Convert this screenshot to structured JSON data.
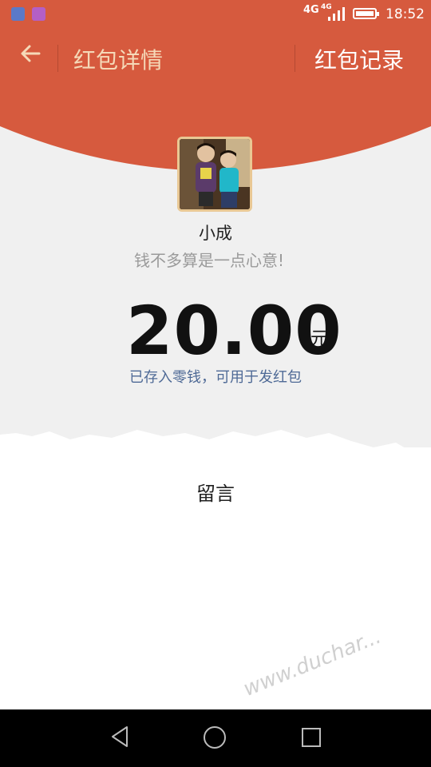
{
  "status_bar": {
    "network": "4G",
    "network2": "4G",
    "time": "18:52"
  },
  "header": {
    "back_icon": "arrow-left-icon",
    "title": "红包详情",
    "records_label": "红包记录"
  },
  "sender": {
    "avatar_icon": "user-avatar-photo",
    "name": "小成",
    "wish": "钱不多算是一点心意!"
  },
  "amount": {
    "value": "20.00",
    "unit": "元",
    "note": "已存入零钱，可用于发红包"
  },
  "message_section": {
    "label": "留言"
  },
  "watermark": {
    "text": "www.duchar..."
  },
  "colors": {
    "brand_red": "#d65a3e",
    "gold_text": "#f5d9b8",
    "note_blue": "#4f6a96"
  },
  "navigation": {
    "back_icon": "triangle-back-icon",
    "home_icon": "circle-home-icon",
    "recent_icon": "square-recent-icon"
  }
}
